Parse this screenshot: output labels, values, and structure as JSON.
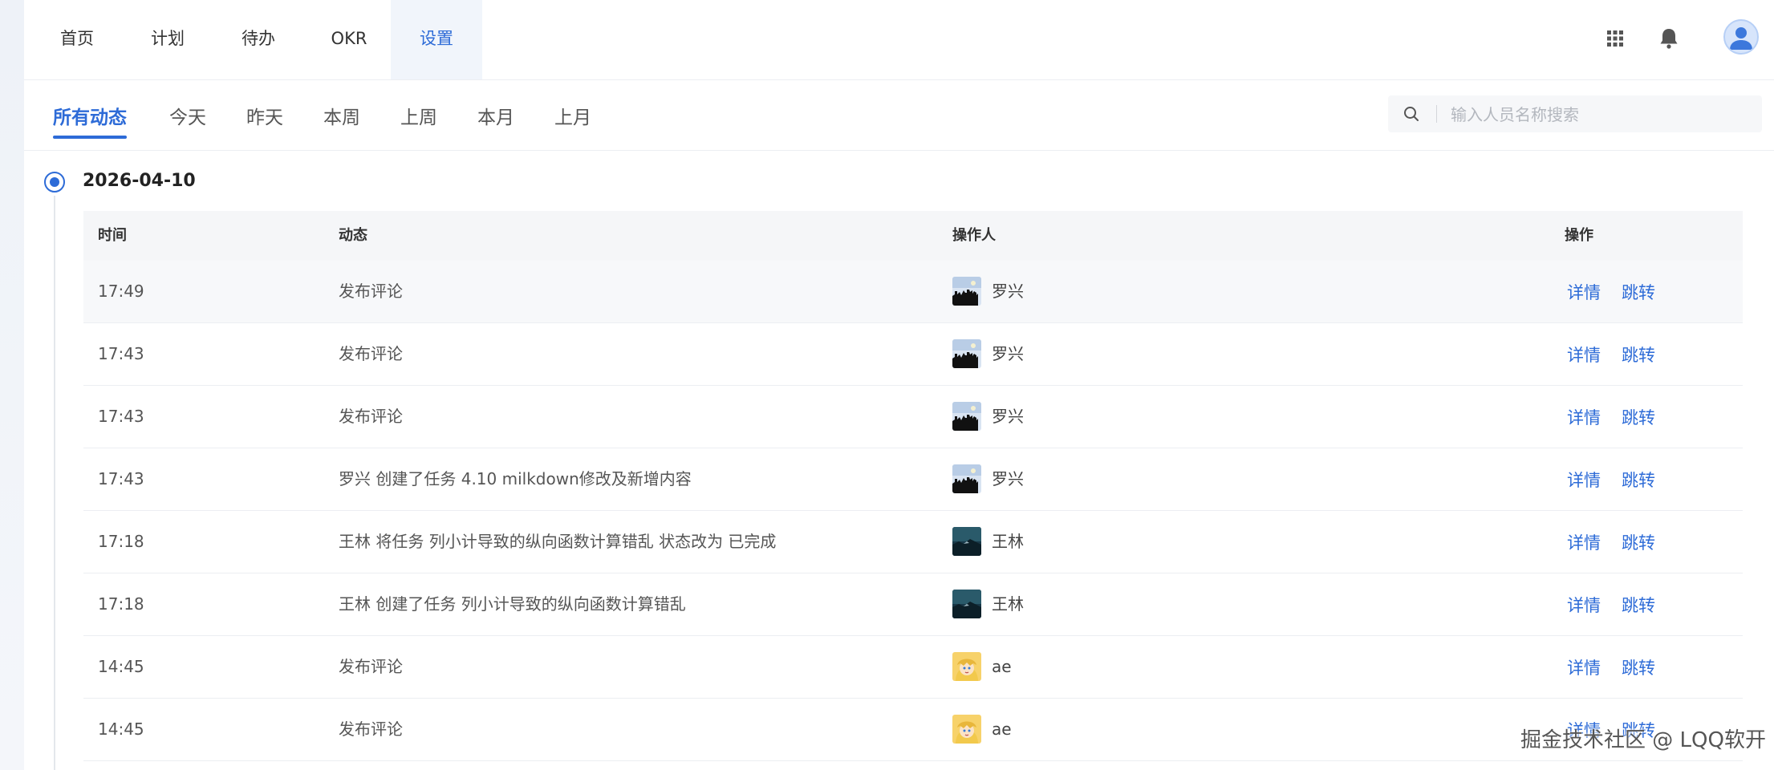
{
  "nav": {
    "tabs": [
      {
        "label": "首页"
      },
      {
        "label": "计划"
      },
      {
        "label": "待办"
      },
      {
        "label": "OKR"
      },
      {
        "label": "设置"
      }
    ],
    "active_tab": "设置"
  },
  "filters": {
    "tabs": [
      {
        "label": "所有动态"
      },
      {
        "label": "今天"
      },
      {
        "label": "昨天"
      },
      {
        "label": "本周"
      },
      {
        "label": "上周"
      },
      {
        "label": "本月"
      },
      {
        "label": "上月"
      }
    ],
    "active": "所有动态"
  },
  "search": {
    "placeholder": "输入人员名称搜索"
  },
  "timeline": {
    "date": "2026-04-10",
    "columns": {
      "time": "时间",
      "activity": "动态",
      "operator": "操作人",
      "action": "操作"
    },
    "action_labels": {
      "detail": "详情",
      "jump": "跳转"
    },
    "rows": [
      {
        "time": "17:49",
        "activity": "发布评论",
        "operator": "罗兴",
        "avatar": "night-city"
      },
      {
        "time": "17:43",
        "activity": "发布评论",
        "operator": "罗兴",
        "avatar": "night-city"
      },
      {
        "time": "17:43",
        "activity": "发布评论",
        "operator": "罗兴",
        "avatar": "night-city"
      },
      {
        "time": "17:43",
        "activity": "罗兴 创建了任务 4.10 milkdown修改及新增内容",
        "operator": "罗兴",
        "avatar": "night-city"
      },
      {
        "time": "17:18",
        "activity": "王林 将任务 列小计导致的纵向函数计算错乱 状态改为 已完成",
        "operator": "王林",
        "avatar": "dark-lake"
      },
      {
        "time": "17:18",
        "activity": "王林 创建了任务 列小计导致的纵向函数计算错乱",
        "operator": "王林",
        "avatar": "dark-lake"
      },
      {
        "time": "14:45",
        "activity": "发布评论",
        "operator": "ae",
        "avatar": "anime-girl"
      },
      {
        "time": "14:45",
        "activity": "发布评论",
        "operator": "ae",
        "avatar": "anime-girl"
      }
    ]
  },
  "watermark": "掘金技术社区 @ LQQ软开",
  "colors": {
    "primary": "#2d6bd7",
    "header_bg": "#f5f6f8",
    "border": "#eceef2"
  }
}
